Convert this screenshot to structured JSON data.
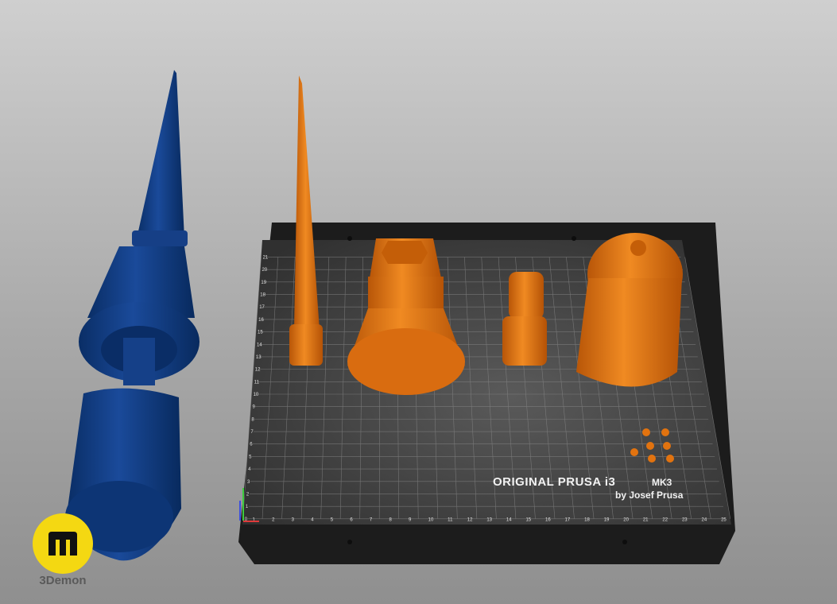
{
  "bed": {
    "title": "ORIGINAL PRUSA i3",
    "model": "MK3",
    "subtitle": "by Josef Prusa",
    "x_ticks": [
      "1",
      "2",
      "3",
      "4",
      "5",
      "6",
      "7",
      "8",
      "9",
      "10",
      "11",
      "12",
      "13",
      "14",
      "15",
      "16",
      "17",
      "18",
      "19",
      "20",
      "21",
      "22",
      "23",
      "24",
      "25"
    ],
    "y_ticks": [
      "0",
      "1",
      "2",
      "3",
      "4",
      "5",
      "6",
      "7",
      "8",
      "9",
      "10",
      "11",
      "12",
      "13",
      "14",
      "15",
      "16",
      "17",
      "18",
      "19",
      "20",
      "21"
    ]
  },
  "colors": {
    "model_blue": "#0b3b82",
    "model_orange": "#e2730f",
    "bed_dark": "#2b2b2b",
    "logo_yellow": "#f4d812"
  },
  "logo": {
    "text": "3Demon"
  }
}
